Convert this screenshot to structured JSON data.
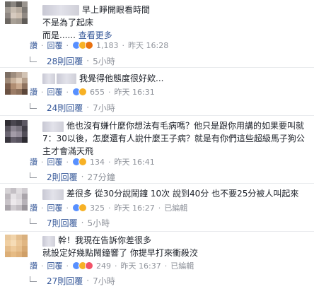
{
  "comments": [
    {
      "line1": "早上睜開眼看時間",
      "line2": "不是為了起床",
      "line3": "而是......",
      "see_more": "查看更多",
      "actions": {
        "like": "讚",
        "reply": "回覆",
        "count": "1,183",
        "time": "昨天 16:28"
      },
      "replies": {
        "label": "28則回覆",
        "time": "5小時"
      }
    },
    {
      "line1": "我覺得他態度很好欸...",
      "actions": {
        "like": "讚",
        "reply": "回覆",
        "count": "655",
        "time": "昨天 16:31"
      },
      "replies": {
        "label": "24則回覆",
        "time": "7小時"
      }
    },
    {
      "line1": "他也沒有嫌什麼你想法有毛病嗎？他只是跟你用講的如果要叫就",
      "line2": "7：30以後，怎麼還有人說什麼王子病？就是有你們這些超級馬子狗公",
      "line3": "主才會滿天飛",
      "actions": {
        "like": "讚",
        "reply": "回覆",
        "count": "134",
        "time": "昨天 16:41"
      },
      "replies": {
        "label": "2則回覆",
        "time": "27分鐘"
      }
    },
    {
      "line1": "差很多 從30分說鬧鐘 10次 說到40分 也不要25分被人叫起來",
      "actions": {
        "like": "讚",
        "reply": "回覆",
        "count": "325",
        "time": "昨天 16:27",
        "edited": "已編輯"
      },
      "replies": {
        "label": "7則回覆",
        "time": "5小時"
      }
    },
    {
      "line1": "幹！我現在告訴你差很多",
      "line2": "就設定好幾點鬧鐘響了 你提早打來衝殺洨",
      "actions": {
        "like": "讚",
        "reply": "回覆",
        "count": "249",
        "time": "昨天 16:37",
        "edited": "已編輯"
      },
      "replies": {
        "label": "27則回覆",
        "time": "7小時"
      }
    }
  ],
  "reaction_icons": [
    "like-icon",
    "haha-icon",
    "angry-icon",
    "love-icon"
  ],
  "colors": {
    "link": "#365899",
    "meta": "#90949c",
    "text": "#1d2129",
    "like": "#5890ff",
    "haha": "#f7b125",
    "angry": "#e9710f",
    "love": "#f25268"
  }
}
